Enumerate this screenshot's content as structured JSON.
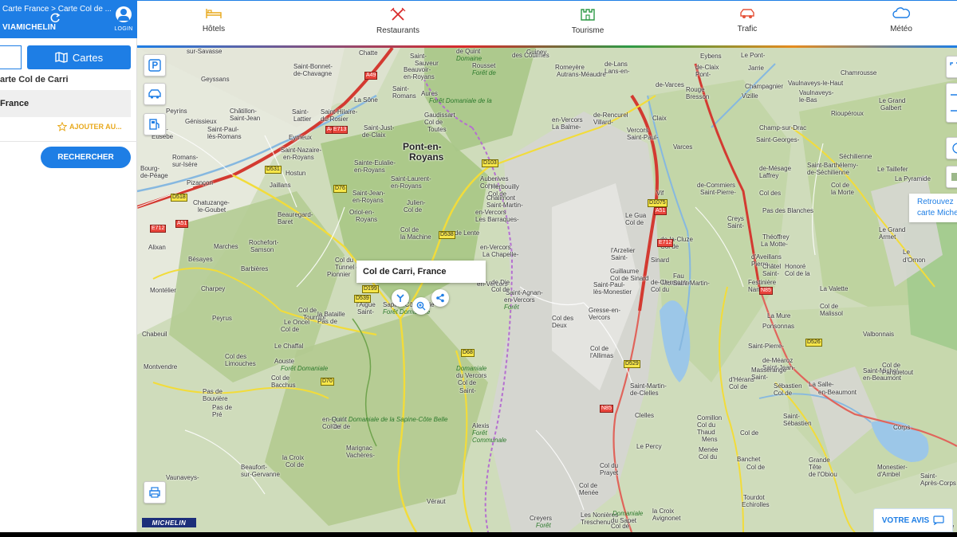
{
  "sidebar": {
    "breadcrumb": "Carte France > Carte Col de ...",
    "brand": "VIAMICHELIN",
    "login_label": "LOGIN",
    "cartes_label": "Cartes",
    "title": "arte Col de Carri",
    "result": "France",
    "add_label": "AJOUTER AU...",
    "search_label": "RECHERCHER"
  },
  "nav": {
    "items": [
      {
        "label": "Hôtels",
        "icon": "bed-icon",
        "color": "#e8a91c"
      },
      {
        "label": "Restaurants",
        "icon": "fork-knife-icon",
        "color": "#d82a2a"
      },
      {
        "label": "Tourisme",
        "icon": "castle-icon",
        "color": "#2e9a46"
      },
      {
        "label": "Trafic",
        "icon": "car-icon",
        "color": "#e5533a"
      },
      {
        "label": "Météo",
        "icon": "cloud-icon",
        "color": "#1e7ee5"
      }
    ]
  },
  "map": {
    "popup_title": "Col de Carri, France",
    "retrouvez": [
      "Retrouvez",
      "carte Michel"
    ],
    "votre_avis": "VOTRE AVIS",
    "logo": "MICHELIN",
    "places": [
      {
        "t": "Pont-en-",
        "c": "big"
      },
      {
        "t": "Royans",
        "c": "big"
      },
      {
        "t": "sur-Savasse"
      },
      {
        "t": "Geyssans"
      },
      {
        "t": "Peyrins"
      },
      {
        "t": "Génissieux"
      },
      {
        "t": "Saint-"
      },
      {
        "t": "Eusèbe"
      },
      {
        "t": "Romans-"
      },
      {
        "t": "sur-Isère"
      },
      {
        "t": "Bourg-"
      },
      {
        "t": "de-Péage"
      },
      {
        "t": "Châtillon-"
      },
      {
        "t": "Saint-Jean"
      },
      {
        "t": "Saint-Paul-"
      },
      {
        "t": "lès-Romans"
      },
      {
        "t": "Eymeux"
      },
      {
        "t": "Saint-Nazaire-"
      },
      {
        "t": "en-Royans"
      },
      {
        "t": "Hostun"
      },
      {
        "t": "Pizançon"
      },
      {
        "t": "Jaillans"
      },
      {
        "t": "Chatuzange-"
      },
      {
        "t": "le-Goubet"
      },
      {
        "t": "Beauregard-"
      },
      {
        "t": "Baret"
      },
      {
        "t": "Alixan"
      },
      {
        "t": "Marches"
      },
      {
        "t": "Rochefort-"
      },
      {
        "t": "Samson"
      },
      {
        "t": "Bésayes"
      },
      {
        "t": "Barbières"
      },
      {
        "t": "Montélier"
      },
      {
        "t": "Charpey"
      },
      {
        "t": "Chabeuil"
      },
      {
        "t": "Peyrus"
      },
      {
        "t": "Le Chaffal"
      },
      {
        "t": "Montvendre"
      },
      {
        "t": "Col des"
      },
      {
        "t": "Limouches"
      },
      {
        "t": "Col de"
      },
      {
        "t": "Bacchus"
      },
      {
        "t": "Pas de"
      },
      {
        "t": "Bouvière"
      },
      {
        "t": "Pas de"
      },
      {
        "t": "Pré"
      },
      {
        "t": "Vaunaveys-"
      },
      {
        "t": "Beaufort-"
      },
      {
        "t": "sur-Gervanne"
      },
      {
        "t": "Chatte"
      },
      {
        "t": "Saint-Bonnet-"
      },
      {
        "t": "de-Chavagne"
      },
      {
        "t": "Saint-"
      },
      {
        "t": "Lattier"
      },
      {
        "t": "Saint-Hilaire-"
      },
      {
        "t": "du-Rosier"
      },
      {
        "t": "La Sône"
      },
      {
        "t": "Saint-"
      },
      {
        "t": "Romans"
      },
      {
        "t": "Saint-Just-"
      },
      {
        "t": "de-Claix"
      },
      {
        "t": "Beauvoir-"
      },
      {
        "t": "en-Royans"
      },
      {
        "t": "Saint-"
      },
      {
        "t": "Sauveur"
      },
      {
        "t": "Sainte-Eulalie-"
      },
      {
        "t": "en-Royans"
      },
      {
        "t": "Saint-Laurent-"
      },
      {
        "t": "en-Royans"
      },
      {
        "t": "Saint-Jean-"
      },
      {
        "t": "en-Royans"
      },
      {
        "t": "Oriol-en-"
      },
      {
        "t": "Royans"
      },
      {
        "t": "Col de"
      },
      {
        "t": "la Machine"
      },
      {
        "t": "Col du"
      },
      {
        "t": "Tunnel du"
      },
      {
        "t": "Pionnier"
      },
      {
        "t": "Col de"
      },
      {
        "t": "Tourniol"
      },
      {
        "t": "Le Oncel"
      },
      {
        "t": "Col de"
      },
      {
        "t": "la Bataille"
      },
      {
        "t": "Pas de"
      },
      {
        "t": "l'Aigue"
      },
      {
        "t": "Saint-"
      },
      {
        "t": "Julien-"
      },
      {
        "t": "Col de"
      },
      {
        "t": "Gaudissart"
      },
      {
        "t": "Col de"
      },
      {
        "t": "Toutes"
      },
      {
        "t": "Aures"
      },
      {
        "t": "Forêt Domaniale de la"
      },
      {
        "t": "Sapine-Côte Belle"
      },
      {
        "t": "Forêt Domaniale"
      },
      {
        "t": "de Lente"
      },
      {
        "t": "Forêt Domaniale de la Sapine-Côte Belle"
      },
      {
        "t": "Col de"
      },
      {
        "t": "Marignac"
      },
      {
        "t": "Vachères-"
      },
      {
        "t": "en-Quint"
      },
      {
        "t": "Col de"
      },
      {
        "t": "la Croix"
      },
      {
        "t": "Col de"
      },
      {
        "t": "Véraut"
      },
      {
        "t": "Die"
      },
      {
        "t": "Aouste"
      },
      {
        "t": "Forêt Domaniale"
      },
      {
        "t": "de Quint"
      },
      {
        "t": "Domaine"
      },
      {
        "t": "des Coulmes"
      },
      {
        "t": "Auberives"
      },
      {
        "t": "Col de"
      },
      {
        "t": "l'Herbouilly"
      },
      {
        "t": "Col de"
      },
      {
        "t": "Chalimont"
      },
      {
        "t": "Saint-Martin-"
      },
      {
        "t": "en-Vercors"
      },
      {
        "t": "Les Barraques-"
      },
      {
        "t": "en-Vercors"
      },
      {
        "t": "La Chapelle-"
      },
      {
        "t": "en-Vercors"
      },
      {
        "t": "Saint-Agnan-"
      },
      {
        "t": "en-Vercors"
      },
      {
        "t": "Forêt"
      },
      {
        "t": "Domaniale"
      },
      {
        "t": "du Vercors"
      },
      {
        "t": "Col de"
      },
      {
        "t": "Saint-"
      },
      {
        "t": "Alexis"
      },
      {
        "t": "Forêt"
      },
      {
        "t": "Communale"
      },
      {
        "t": "de Die"
      },
      {
        "t": "Col de"
      },
      {
        "t": "Rousset"
      },
      {
        "t": "Forêt de"
      },
      {
        "t": "Guiney"
      },
      {
        "t": "Romeyère"
      },
      {
        "t": "Autrans-Méaudre"
      },
      {
        "t": "en-Vercors"
      },
      {
        "t": "La Balme-"
      },
      {
        "t": "de-Rencurel"
      },
      {
        "t": "Villard-"
      },
      {
        "t": "de-Lans"
      },
      {
        "t": "Lans-en-"
      },
      {
        "t": "Vercors"
      },
      {
        "t": "Saint-Paul-"
      },
      {
        "t": "de-Varces"
      },
      {
        "t": "Claix"
      },
      {
        "t": "Varces"
      },
      {
        "t": "Vif"
      },
      {
        "t": "Le Gua"
      },
      {
        "t": "Col de"
      },
      {
        "t": "l'Arzelier"
      },
      {
        "t": "Saint-"
      },
      {
        "t": "Guillaume"
      },
      {
        "t": "Col de Sinard"
      },
      {
        "t": "Saint-Paul-"
      },
      {
        "t": "lès-Monestier"
      },
      {
        "t": "Col des"
      },
      {
        "t": "Deux"
      },
      {
        "t": "Gresse-en-"
      },
      {
        "t": "Vercors"
      },
      {
        "t": "Col de"
      },
      {
        "t": "l'Allimas"
      },
      {
        "t": "Saint-Martin-"
      },
      {
        "t": "de-Clelles"
      },
      {
        "t": "Clelles"
      },
      {
        "t": "Le Percy"
      },
      {
        "t": "Col du"
      },
      {
        "t": "Prayet"
      },
      {
        "t": "Col de"
      },
      {
        "t": "Menée"
      },
      {
        "t": "Les Nonières"
      },
      {
        "t": "Treschenu-"
      },
      {
        "t": "Creyers"
      },
      {
        "t": "Forêt"
      },
      {
        "t": "Domaniale"
      },
      {
        "t": "du Sapet"
      },
      {
        "t": "Col de"
      },
      {
        "t": "la Croix"
      },
      {
        "t": "Avignonet"
      },
      {
        "t": "Sinard"
      },
      {
        "t": "Monestier-"
      },
      {
        "t": "de-Clermont"
      },
      {
        "t": "Col du"
      },
      {
        "t": "Fau"
      },
      {
        "t": "Saint-Martin-"
      },
      {
        "t": "de-la-Cluze"
      },
      {
        "t": "Col de"
      },
      {
        "t": "Comillon"
      },
      {
        "t": "Col du"
      },
      {
        "t": "Thaud"
      },
      {
        "t": "Mens"
      },
      {
        "t": "Col de"
      },
      {
        "t": "Menée"
      },
      {
        "t": "Col du"
      },
      {
        "t": "Banchet"
      },
      {
        "t": "Col de"
      },
      {
        "t": "Tourdot"
      },
      {
        "t": "Echirolles"
      },
      {
        "t": "Eybens"
      },
      {
        "t": "Le Pont-"
      },
      {
        "t": "de-Claix"
      },
      {
        "t": "Pont-"
      },
      {
        "t": "Rouge"
      },
      {
        "t": "Bresson"
      },
      {
        "t": "Jarrie"
      },
      {
        "t": "Champagnier"
      },
      {
        "t": "Vizille"
      },
      {
        "t": "Champ-sur-Drac"
      },
      {
        "t": "Saint-Georges-"
      },
      {
        "t": "de-Commiers"
      },
      {
        "t": "Saint-Pierre-"
      },
      {
        "t": "de-Mésage"
      },
      {
        "t": "Laffrey"
      },
      {
        "t": "Col des"
      },
      {
        "t": "Creys"
      },
      {
        "t": "Saint-"
      },
      {
        "t": "Théoffrey"
      },
      {
        "t": "La Motte-"
      },
      {
        "t": "d'Aveillans"
      },
      {
        "t": "Pierre-"
      },
      {
        "t": "Châtel"
      },
      {
        "t": "Saint-"
      },
      {
        "t": "Honoré"
      },
      {
        "t": "Col de la"
      },
      {
        "t": "Festinière"
      },
      {
        "t": "Nantizon"
      },
      {
        "t": "La Mure"
      },
      {
        "t": "Ponsonnas"
      },
      {
        "t": "Saint-Pierre-"
      },
      {
        "t": "de-Méaroz"
      },
      {
        "t": "Saint-Jean-"
      },
      {
        "t": "d'Hérans"
      },
      {
        "t": "Col de"
      },
      {
        "t": "Masserange"
      },
      {
        "t": "Saint-"
      },
      {
        "t": "Sébastien"
      },
      {
        "t": "Col de"
      },
      {
        "t": "Saint-"
      },
      {
        "t": "Sébastien"
      },
      {
        "t": "La Salle-"
      },
      {
        "t": "en-Beaumont"
      },
      {
        "t": "Saint-Michel-"
      },
      {
        "t": "en-Beaumont"
      },
      {
        "t": "Col de"
      },
      {
        "t": "Parquetout"
      },
      {
        "t": "Grande"
      },
      {
        "t": "Tête"
      },
      {
        "t": "de l'Obiou"
      },
      {
        "t": "Corps"
      },
      {
        "t": "Monestier-"
      },
      {
        "t": "d'Ambel"
      },
      {
        "t": "Saint-"
      },
      {
        "t": "Après-Corps"
      },
      {
        "t": "Saint-"
      },
      {
        "t": "en-Valgode"
      },
      {
        "t": "Vaulnaveys-le-Haut"
      },
      {
        "t": "Vaulnaveys-"
      },
      {
        "t": "le-Bas"
      },
      {
        "t": "Chamrousse"
      },
      {
        "t": "Le Grand"
      },
      {
        "t": "Galbert"
      },
      {
        "t": "Rioupéroux"
      },
      {
        "t": "Séchilienne"
      },
      {
        "t": "Saint-Barthélemy-"
      },
      {
        "t": "de-Séchilienne"
      },
      {
        "t": "Le Taillefer"
      },
      {
        "t": "Col de"
      },
      {
        "t": "la Morte"
      },
      {
        "t": "La Pyramide"
      },
      {
        "t": "Pas des Blanches"
      },
      {
        "t": "Le Grand"
      },
      {
        "t": "Armet"
      },
      {
        "t": "Le"
      },
      {
        "t": "d'Ornon"
      },
      {
        "t": "Col de"
      },
      {
        "t": "Malissol"
      },
      {
        "t": "La Valette"
      },
      {
        "t": "Valbonnais"
      },
      {
        "t": "A49",
        "c": "road red"
      },
      {
        "t": "A49",
        "c": "road red"
      },
      {
        "t": "E713",
        "c": "road red"
      },
      {
        "t": "D531",
        "c": "road"
      },
      {
        "t": "D518",
        "c": "road"
      },
      {
        "t": "D103",
        "c": "road"
      },
      {
        "t": "D76",
        "c": "road"
      },
      {
        "t": "D199",
        "c": "road"
      },
      {
        "t": "D539",
        "c": "road"
      },
      {
        "t": "D538",
        "c": "road"
      },
      {
        "t": "D68",
        "c": "road"
      },
      {
        "t": "D70",
        "c": "road"
      },
      {
        "t": "A51",
        "c": "road red"
      },
      {
        "t": "E712",
        "c": "road red"
      },
      {
        "t": "A51",
        "c": "road red"
      },
      {
        "t": "D1075",
        "c": "road"
      },
      {
        "t": "E712",
        "c": "road red"
      },
      {
        "t": "D529",
        "c": "road"
      },
      {
        "t": "N85",
        "c": "road red"
      },
      {
        "t": "D526",
        "c": "road"
      },
      {
        "t": "N85",
        "c": "road red"
      }
    ]
  }
}
